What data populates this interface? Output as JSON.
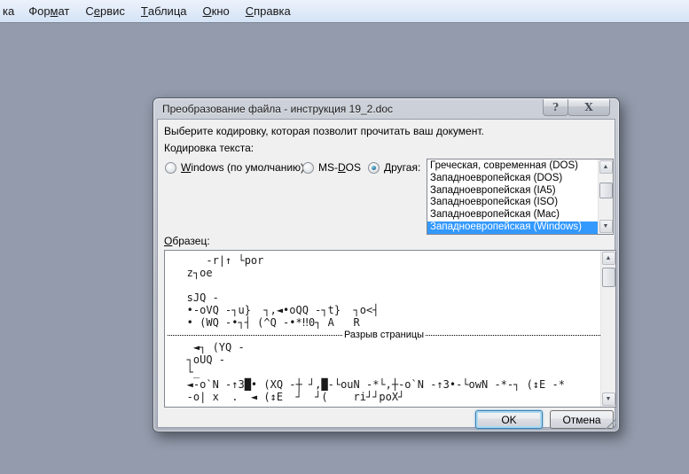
{
  "menu": {
    "items": [
      {
        "pre": "ка",
        "key": "",
        "post": ""
      },
      {
        "pre": "Фор",
        "key": "м",
        "post": "ат"
      },
      {
        "pre": "С",
        "key": "е",
        "post": "рвис"
      },
      {
        "pre": "",
        "key": "Т",
        "post": "аблица"
      },
      {
        "pre": "",
        "key": "О",
        "post": "кно"
      },
      {
        "pre": "",
        "key": "С",
        "post": "правка"
      }
    ]
  },
  "window": {
    "title": "Преобразование файла - инструкция 19_2.doc",
    "help_glyph": "?",
    "close_glyph": "X"
  },
  "dialog": {
    "instruction": "Выберите кодировку, которая позволит прочитать ваш документ.",
    "encoding_label": "Кодировка текста:",
    "radios": [
      {
        "pre": "",
        "key": "W",
        "post": "indows (по умолчанию)",
        "selected": false
      },
      {
        "pre": "MS-",
        "key": "D",
        "post": "OS",
        "selected": false
      },
      {
        "pre": "",
        "key": "Д",
        "post": "ругая:",
        "selected": true
      }
    ],
    "encodings": {
      "items": [
        "Греческая, современная (DOS)",
        "Западноевропейская (DOS)",
        "Западноевропейская (IA5)",
        "Западноевропейская (ISO)",
        "Западноевропейская (Mac)",
        "Западноевропейская (Windows)"
      ],
      "selected_index": 5
    },
    "sample": {
      "pre": "",
      "key": "О",
      "post": "бразец:"
    },
    "preview": {
      "lines_before": [
        "      -r|↑ └por",
        "   z┐oe",
        "",
        "   sJQ -",
        "   •-oVQ -┐u}  ┐,◄•oQQ -┐t}  ┐o<┤",
        "   • (WQ -•┐┤ (^Q -•*‼0┐ A   R"
      ],
      "page_break_label": "Разрыв страницы",
      "lines_after": [
        "    ◄┐ (YQ -",
        "   ┐oUQ -",
        "   └_",
        "   ◄-o`N -↑3█• (XQ -┼ ┘,█-└ouN -*└,┼-o`N -↑3•-└owN -*-┐ (↕E -*",
        "   -o| x  .  ◄ (↕E  ┘  ┘(    ri┘┘poX┘"
      ]
    },
    "buttons": {
      "ok": "OK",
      "cancel": "Отмена"
    }
  },
  "colors": {
    "desktop": "#939bac",
    "menubar": "#d9e5f6",
    "selection": "#3399ff",
    "dialog_content": "#f0f0f0"
  }
}
